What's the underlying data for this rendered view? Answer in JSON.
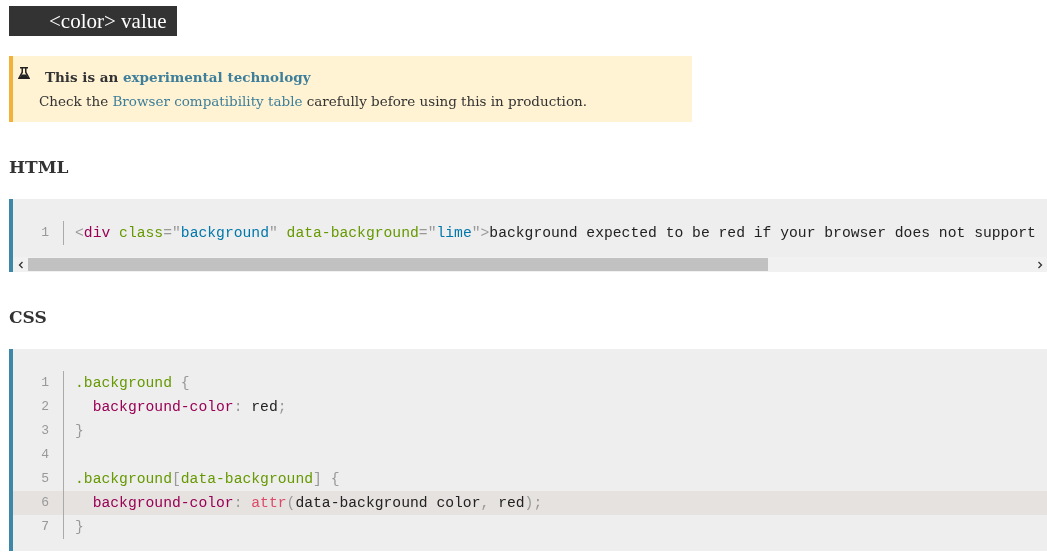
{
  "title": "<color> value",
  "notice": {
    "heading_plain": "This is an ",
    "heading_link": "experimental technology",
    "body_before": "Check the ",
    "body_link": "Browser compatibility table",
    "body_after": " carefully before using this in production."
  },
  "sections": [
    {
      "heading": "HTML",
      "scrollbar": true,
      "lines": [
        {
          "number": "1",
          "highlighted": false,
          "tokens": [
            {
              "kind": "punct",
              "text": "<"
            },
            {
              "kind": "tag",
              "text": "div"
            },
            {
              "kind": "attr",
              "text": " class"
            },
            {
              "kind": "punct",
              "text": "=\""
            },
            {
              "kind": "string",
              "text": "background"
            },
            {
              "kind": "punct",
              "text": "\""
            },
            {
              "kind": "attr",
              "text": " data-background"
            },
            {
              "kind": "punct",
              "text": "=\""
            },
            {
              "kind": "string",
              "text": "lime"
            },
            {
              "kind": "punct",
              "text": "\">"
            },
            {
              "kind": "plain",
              "text": "background expected to be red if your browser does not support"
            }
          ]
        }
      ]
    },
    {
      "heading": "CSS",
      "scrollbar": false,
      "lines": [
        {
          "number": "1",
          "highlighted": false,
          "tokens": [
            {
              "kind": "attr",
              "text": ".background"
            },
            {
              "kind": "punct",
              "text": " {"
            }
          ]
        },
        {
          "number": "2",
          "highlighted": false,
          "tokens": [
            {
              "kind": "tag",
              "text": "  background-color"
            },
            {
              "kind": "punct",
              "text": ":"
            },
            {
              "kind": "plain",
              "text": " red"
            },
            {
              "kind": "punct",
              "text": ";"
            }
          ]
        },
        {
          "number": "3",
          "highlighted": false,
          "tokens": [
            {
              "kind": "punct",
              "text": "}"
            }
          ]
        },
        {
          "number": "4",
          "highlighted": false
        },
        {
          "number": "5",
          "highlighted": false,
          "tokens": [
            {
              "kind": "attr",
              "text": ".background"
            },
            {
              "kind": "punct",
              "text": "["
            },
            {
              "kind": "attr",
              "text": "data-background"
            },
            {
              "kind": "punct",
              "text": "] {"
            }
          ]
        },
        {
          "number": "6",
          "highlighted": true,
          "tokens": [
            {
              "kind": "tag",
              "text": "  background-color"
            },
            {
              "kind": "punct",
              "text": ":"
            },
            {
              "kind": "func",
              "text": " attr"
            },
            {
              "kind": "punct",
              "text": "("
            },
            {
              "kind": "plain",
              "text": "data-background color"
            },
            {
              "kind": "punct",
              "text": ","
            },
            {
              "kind": "plain",
              "text": " red"
            },
            {
              "kind": "punct",
              "text": ");"
            }
          ]
        },
        {
          "number": "7",
          "highlighted": false,
          "tokens": [
            {
              "kind": "punct",
              "text": "}"
            }
          ]
        }
      ]
    }
  ]
}
